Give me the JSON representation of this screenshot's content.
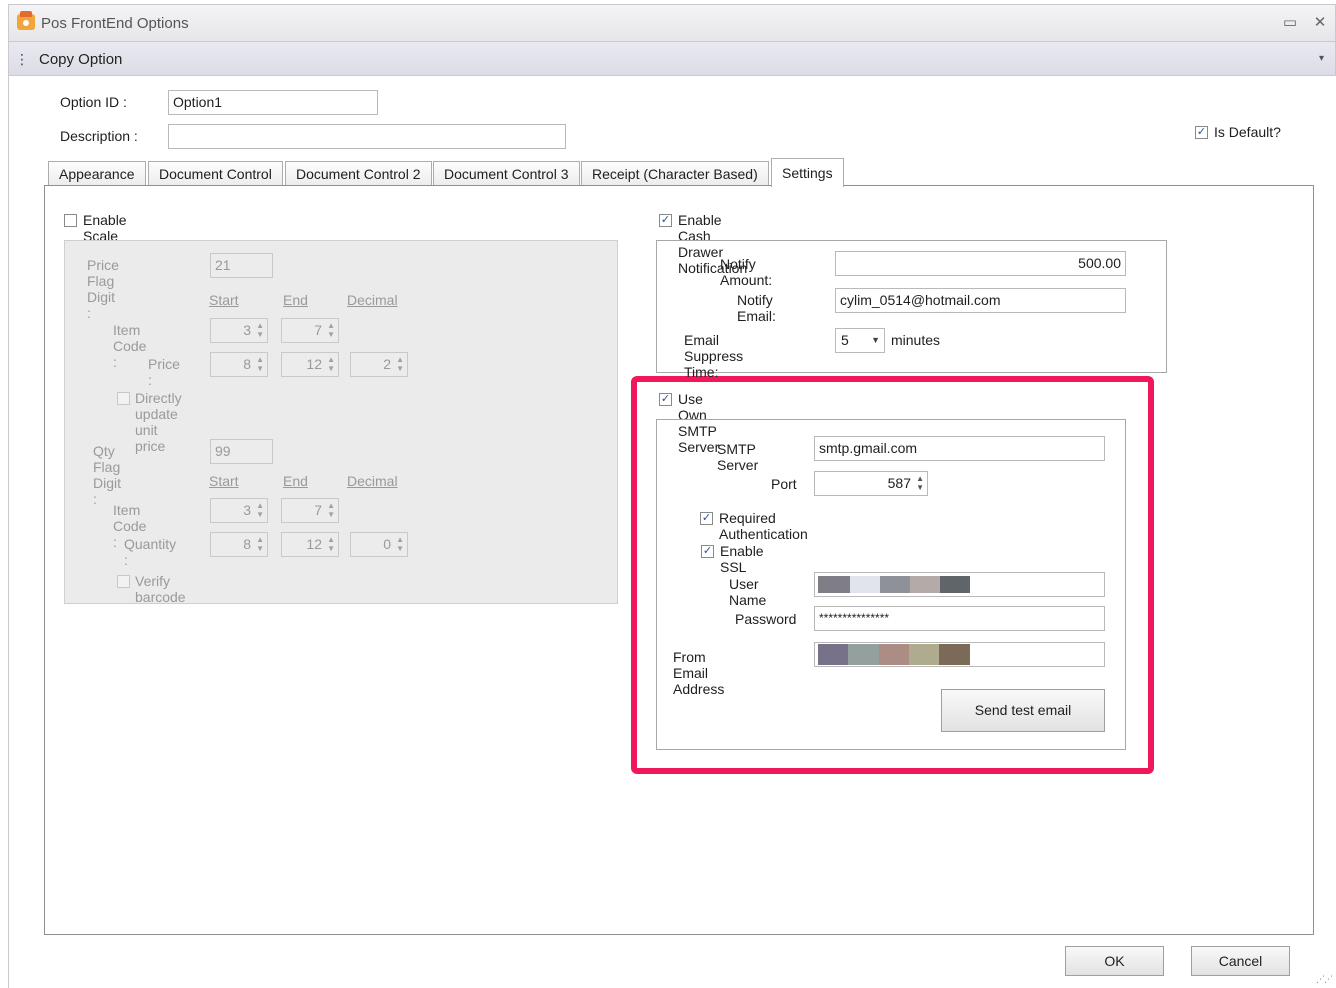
{
  "window": {
    "title": "Pos FrontEnd Options",
    "restore_glyph": "▭",
    "close_glyph": "✕"
  },
  "toolbar": {
    "label": "Copy Option",
    "grip_glyph": "⋮",
    "dropdown_glyph": "▾"
  },
  "header": {
    "option_id_label": "Option ID :",
    "option_id_value": "Option1",
    "description_label": "Description :",
    "description_value": "",
    "is_default_label": "Is Default?",
    "is_default_checked": true
  },
  "tabs": [
    {
      "label": "Appearance"
    },
    {
      "label": "Document Control"
    },
    {
      "label": "Document Control 2"
    },
    {
      "label": "Document Control 3"
    },
    {
      "label": "Receipt (Character Based)"
    },
    {
      "label": "Settings"
    }
  ],
  "scale_barcode": {
    "enable_label": "Enable Scale Barcode",
    "enabled": false,
    "price_flag_label": "Price Flag Digit :",
    "price_flag_value": "21",
    "col_start": "Start",
    "col_end": "End",
    "col_decimal": "Decimal",
    "item_code_label": "Item Code :",
    "price_item_code": {
      "start": "3",
      "end": "7"
    },
    "price_label": "Price :",
    "price_values": {
      "start": "8",
      "end": "12",
      "decimal": "2"
    },
    "directly_update_label": "Directly update unit price",
    "qty_flag_label": "Qty Flag Digit :",
    "qty_flag_value": "99",
    "qty_item_code": {
      "start": "3",
      "end": "7"
    },
    "quantity_label": "Quantity :",
    "quantity_values": {
      "start": "8",
      "end": "12",
      "decimal": "0"
    },
    "verify_label": "Verify barcode"
  },
  "cash_drawer": {
    "enable_label": "Enable Cash Drawer Notification",
    "enabled": true,
    "notify_amount_label": "Notify Amount:",
    "notify_amount_value": "500.00",
    "notify_email_label": "Notify Email:",
    "notify_email_value": "cylim_0514@hotmail.com",
    "suppress_label": "Email Suppress Time:",
    "suppress_value": "5",
    "suppress_unit": "minutes"
  },
  "smtp": {
    "use_own_label": "Use Own SMTP Server",
    "use_own_checked": true,
    "server_label": "SMTP Server",
    "server_value": "smtp.gmail.com",
    "port_label": "Port",
    "port_value": "587",
    "auth_label": "Required Authentication",
    "auth_checked": true,
    "ssl_label": "Enable SSL",
    "ssl_checked": true,
    "user_label": "User Name",
    "password_label": "Password",
    "password_value": "***************",
    "from_label": "From Email Address",
    "send_test_label": "Send test email",
    "highlight_color": "#f0185a",
    "user_redaction_colors": [
      "#7f7e86",
      "#e1e4ec",
      "#8e9198",
      "#b4aaa8",
      "#5f6568"
    ],
    "from_redaction_colors": [
      "#77728a",
      "#94a09d",
      "#ac8d86",
      "#aeab8f",
      "#7b6a58"
    ]
  },
  "footer": {
    "ok_label": "OK",
    "cancel_label": "Cancel"
  },
  "colors": {
    "accent_check": "#2b4f9a",
    "panel_border": "#8f8f8f"
  }
}
